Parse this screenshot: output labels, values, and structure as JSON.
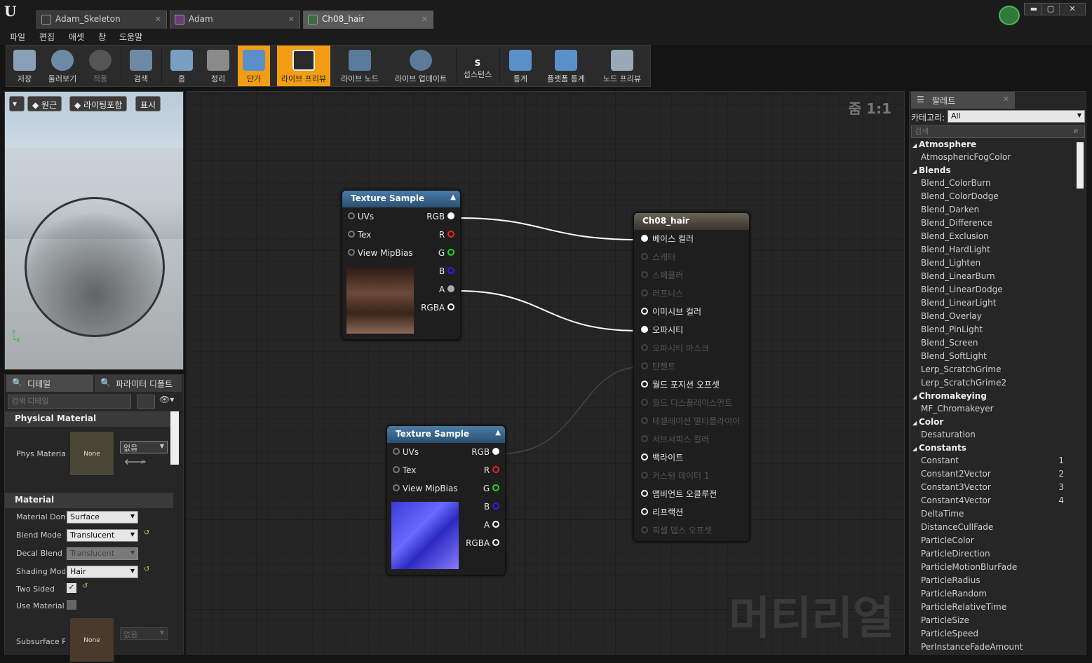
{
  "tabs": [
    {
      "label": "Adam_Skeleton"
    },
    {
      "label": "Adam"
    },
    {
      "label": "Ch08_hair"
    }
  ],
  "menu": [
    "파일",
    "편집",
    "애셋",
    "창",
    "도움말"
  ],
  "toolbar": [
    {
      "label": "저장",
      "icon": "save-icon"
    },
    {
      "label": "둘러보기",
      "icon": "browse-icon"
    },
    {
      "label": "적용",
      "icon": "apply-icon"
    },
    {
      "label": "검색",
      "icon": "search-icon"
    },
    {
      "label": "홈",
      "icon": "home-icon"
    },
    {
      "label": "정리",
      "icon": "clean-icon"
    },
    {
      "label": "단가",
      "icon": "stats-icon"
    },
    {
      "label": "라이브 프리뷰",
      "icon": "live-preview-icon"
    },
    {
      "label": "라이브 노드",
      "icon": "live-nodes-icon"
    },
    {
      "label": "라이브 업데이트",
      "icon": "live-update-icon"
    },
    {
      "label": "섭스턴스",
      "icon": "substance-icon"
    },
    {
      "label": "통계",
      "icon": "stats-bar-icon"
    },
    {
      "label": "플랫폼 통계",
      "icon": "platform-stats-icon"
    },
    {
      "label": "노드 프리뷰",
      "icon": "node-preview-icon"
    }
  ],
  "viewport": {
    "btn_perspective": "원근",
    "btn_lit": "라이팅포함",
    "btn_show": "표시"
  },
  "details": {
    "tab_details": "디테일",
    "tab_params": "파라미터 디폴트",
    "search_placeholder": "검색 디테일",
    "sec_phys": "Physical Material",
    "phys_label": "Phys Material",
    "thumb_none": "None",
    "phys_value": "없음",
    "sec_material": "Material",
    "props": [
      {
        "label": "Material Domain",
        "value": "Surface"
      },
      {
        "label": "Blend Mode",
        "value": "Translucent"
      },
      {
        "label": "Decal Blend Mode",
        "value": "Translucent"
      },
      {
        "label": "Shading Model",
        "value": "Hair"
      },
      {
        "label": "Two Sided",
        "value": ""
      },
      {
        "label": "Use Material Attributes",
        "value": ""
      },
      {
        "label": "Subsurface Profile",
        "value": "없음"
      }
    ]
  },
  "graph": {
    "zoom": "줌 1:1",
    "watermark": "머티리얼"
  },
  "node1": {
    "title": "Texture Sample",
    "inputs": [
      "UVs",
      "Tex",
      "View MipBias"
    ],
    "outputs": [
      "RGB",
      "R",
      "G",
      "B",
      "A",
      "RGBA"
    ]
  },
  "node2": {
    "title": "Texture Sample",
    "inputs": [
      "UVs",
      "Tex",
      "View MipBias"
    ],
    "outputs": [
      "RGB",
      "R",
      "G",
      "B",
      "A",
      "RGBA"
    ]
  },
  "result": {
    "title": "Ch08_hair",
    "pins": [
      {
        "label": "베이스 컬러",
        "active": true
      },
      {
        "label": "스캐터",
        "active": false
      },
      {
        "label": "스페큘러",
        "active": false
      },
      {
        "label": "러프니스",
        "active": false
      },
      {
        "label": "이미시브 컬러",
        "active": true
      },
      {
        "label": "오파시티",
        "active": true
      },
      {
        "label": "오파시티 마스크",
        "active": false
      },
      {
        "label": "탄젠트",
        "active": false
      },
      {
        "label": "월드 포지션 오프셋",
        "active": true
      },
      {
        "label": "월드 디스플레이스먼트",
        "active": false
      },
      {
        "label": "테셀레이션 멀티플라이어",
        "active": false
      },
      {
        "label": "서브서피스 컬러",
        "active": false
      },
      {
        "label": "백라이트",
        "active": true
      },
      {
        "label": "커스텀 데이터 1",
        "active": false
      },
      {
        "label": "앰비언트 오클루전",
        "active": true
      },
      {
        "label": "리프랙션",
        "active": true
      },
      {
        "label": "픽셀 뎁스 오프셋",
        "active": false
      }
    ]
  },
  "palette": {
    "tab": "팔레트",
    "category_label": "카테고리:",
    "category_value": "All",
    "search_placeholder": "검색",
    "rows": [
      {
        "t": "cat",
        "label": "Atmosphere"
      },
      {
        "t": "item",
        "label": "AtmosphericFogColor"
      },
      {
        "t": "cat",
        "label": "Blends"
      },
      {
        "t": "item",
        "label": "Blend_ColorBurn"
      },
      {
        "t": "item",
        "label": "Blend_ColorDodge"
      },
      {
        "t": "item",
        "label": "Blend_Darken"
      },
      {
        "t": "item",
        "label": "Blend_Difference"
      },
      {
        "t": "item",
        "label": "Blend_Exclusion"
      },
      {
        "t": "item",
        "label": "Blend_HardLight"
      },
      {
        "t": "item",
        "label": "Blend_Lighten"
      },
      {
        "t": "item",
        "label": "Blend_LinearBurn"
      },
      {
        "t": "item",
        "label": "Blend_LinearDodge"
      },
      {
        "t": "item",
        "label": "Blend_LinearLight"
      },
      {
        "t": "item",
        "label": "Blend_Overlay"
      },
      {
        "t": "item",
        "label": "Blend_PinLight"
      },
      {
        "t": "item",
        "label": "Blend_Screen"
      },
      {
        "t": "item",
        "label": "Blend_SoftLight"
      },
      {
        "t": "item",
        "label": "Lerp_ScratchGrime"
      },
      {
        "t": "item",
        "label": "Lerp_ScratchGrime2"
      },
      {
        "t": "cat",
        "label": "Chromakeying"
      },
      {
        "t": "item",
        "label": "MF_Chromakeyer"
      },
      {
        "t": "cat",
        "label": "Color"
      },
      {
        "t": "item",
        "label": "Desaturation"
      },
      {
        "t": "cat",
        "label": "Constants"
      },
      {
        "t": "item",
        "label": "Constant",
        "hk": "1"
      },
      {
        "t": "item",
        "label": "Constant2Vector",
        "hk": "2"
      },
      {
        "t": "item",
        "label": "Constant3Vector",
        "hk": "3"
      },
      {
        "t": "item",
        "label": "Constant4Vector",
        "hk": "4"
      },
      {
        "t": "item",
        "label": "DeltaTime"
      },
      {
        "t": "item",
        "label": "DistanceCullFade"
      },
      {
        "t": "item",
        "label": "ParticleColor"
      },
      {
        "t": "item",
        "label": "ParticleDirection"
      },
      {
        "t": "item",
        "label": "ParticleMotionBlurFade"
      },
      {
        "t": "item",
        "label": "ParticleRadius"
      },
      {
        "t": "item",
        "label": "ParticleRandom"
      },
      {
        "t": "item",
        "label": "ParticleRelativeTime"
      },
      {
        "t": "item",
        "label": "ParticleSize"
      },
      {
        "t": "item",
        "label": "ParticleSpeed"
      },
      {
        "t": "item",
        "label": "PerInstanceFadeAmount"
      }
    ]
  }
}
